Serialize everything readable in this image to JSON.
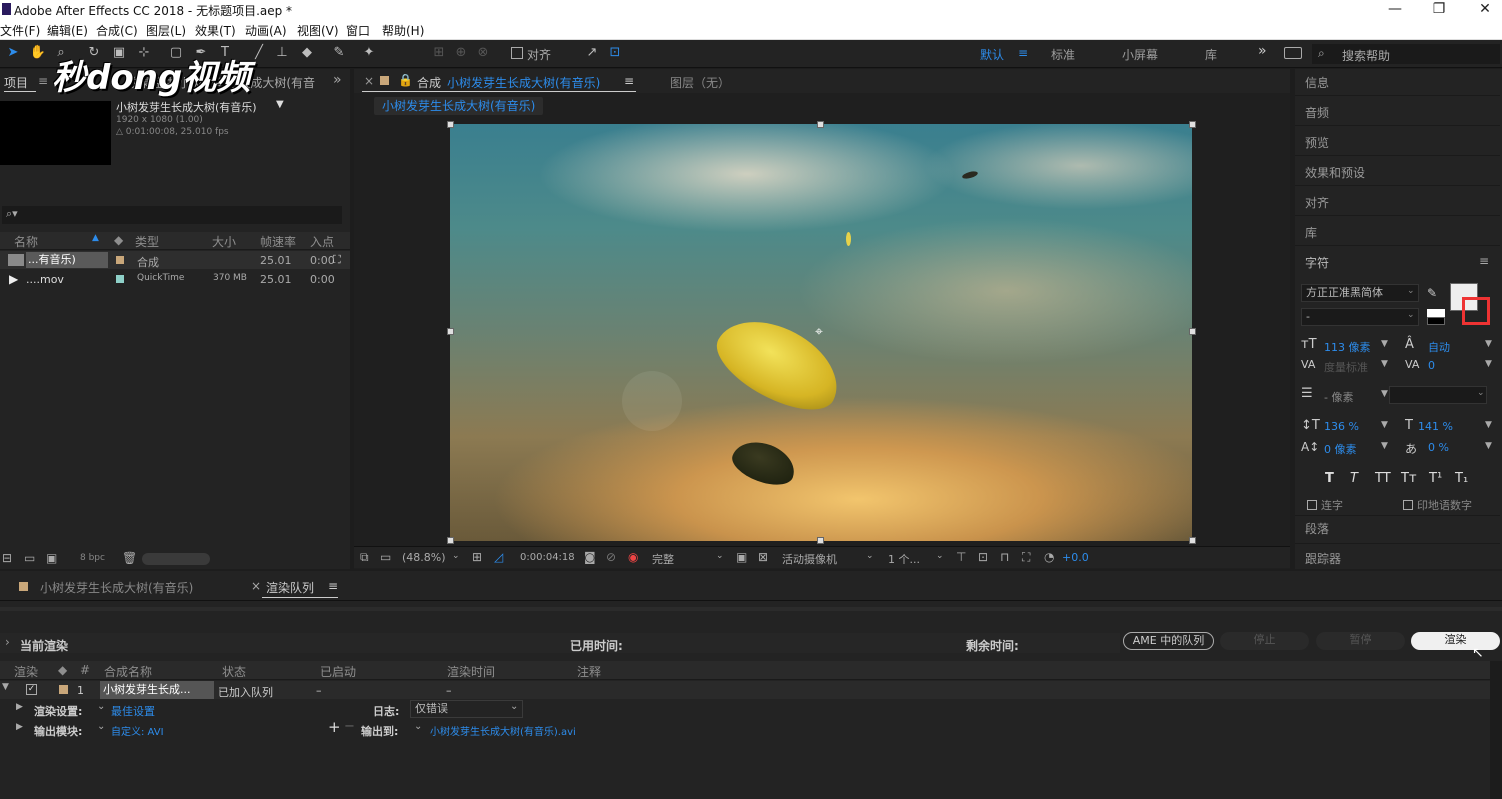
{
  "window": {
    "title": "Adobe After Effects CC 2018 - 无标题项目.aep *",
    "minimize": "—",
    "restore": "❐",
    "close": "✕"
  },
  "menu": [
    "文件(F)",
    "编辑(E)",
    "合成(C)",
    "图层(L)",
    "效果(T)",
    "动画(A)",
    "视图(V)",
    "窗口",
    "帮助(H)"
  ],
  "toolbar": {
    "align_label": "对齐",
    "workspaces": [
      "默认",
      "标准",
      "小屏幕",
      "库"
    ],
    "more": "»",
    "search_placeholder": "搜索帮助"
  },
  "watermark": "秒dong视频",
  "project": {
    "tab": "项目",
    "tab2": "效果控件 小树发芽生长成大树(有音",
    "comp_name": "小树发芽生长成大树(有音乐)",
    "comp_res": "1920 x 1080 (1.00)",
    "comp_dur": "△ 0:01:00:08, 25.010 fps",
    "columns": [
      "名称",
      "类型",
      "大小",
      "帧速率",
      "入点"
    ],
    "rows": [
      {
        "name": "...有音乐)",
        "type": "合成",
        "size": "",
        "fps": "25.01",
        "in": "0:00"
      },
      {
        "name": "....mov",
        "type": "QuickTime",
        "size": "370 MB",
        "fps": "25.01",
        "in": "0:00"
      }
    ],
    "bpc": "8 bpc"
  },
  "viewer": {
    "tab_prefix": "合成",
    "tab_name": "小树发芽生长成大树(有音乐)",
    "layer_tab": "图层（无）",
    "breadcrumb": "小树发芽生长成大树(有音乐)",
    "zoom": "(48.8%)",
    "timecode": "0:00:04:18",
    "quality": "完整",
    "camera": "活动摄像机",
    "views": "1 个...",
    "exposure": "+0.0"
  },
  "right_panel": {
    "items": [
      "信息",
      "音频",
      "预览",
      "效果和预设",
      "对齐",
      "库",
      "字符"
    ],
    "font": "方正正准黑简体",
    "style": "-",
    "size": "113 像素",
    "leading": "自动",
    "kerning": "度量标准",
    "tracking": "0",
    "stroke": "- 像素",
    "vscale": "136 %",
    "hscale": "141 %",
    "baseline": "0 像素",
    "tsume": "0 %",
    "styles": [
      "T",
      "T",
      "TT",
      "Tт",
      "T¹",
      "T₁"
    ],
    "ligature": "连字",
    "hindi": "印地语数字",
    "paragraph": "段落",
    "tracker": "跟踪器"
  },
  "bottom": {
    "tab1": "小树发芽生长成大树(有音乐)",
    "tab2": "渲染队列",
    "current_render": "当前渲染",
    "elapsed": "已用时间:",
    "remaining": "剩余时间:",
    "ame": "AME 中的队列",
    "stop": "停止",
    "pause": "暂停",
    "render": "渲染",
    "columns": [
      "渲染",
      "#",
      "合成名称",
      "状态",
      "已启动",
      "渲染时间",
      "注释"
    ],
    "item": {
      "num": "1",
      "name": "小树发芽生长成...",
      "status": "已加入队列",
      "started": "–",
      "time": "–"
    },
    "render_settings_label": "渲染设置:",
    "render_settings_value": "最佳设置",
    "log_label": "日志:",
    "log_value": "仅错误",
    "output_module_label": "输出模块:",
    "output_module_value": "自定义: AVI",
    "output_to_label": "输出到:",
    "output_to_value": "小树发芽生长成大树(有音乐).avi"
  }
}
